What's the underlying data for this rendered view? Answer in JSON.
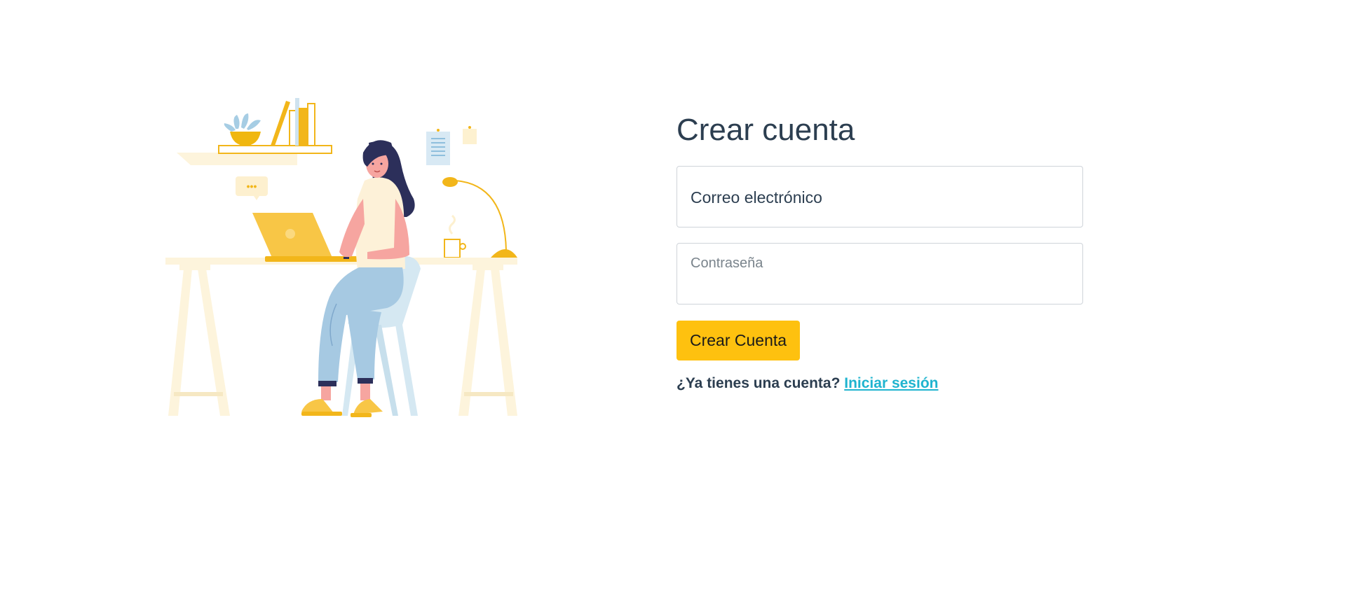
{
  "form": {
    "title": "Crear cuenta",
    "email_label": "Correo electrónico",
    "password_placeholder": "Contraseña",
    "submit_label": "Crear Cuenta",
    "login_prompt": "¿Ya tienes una cuenta?",
    "login_link": "Iniciar sesión"
  },
  "illustration": {
    "subject": "woman working on laptop at desk",
    "chat_bubble": "•••"
  },
  "colors": {
    "accent": "#fec10f",
    "link": "#1fb4cf",
    "text": "#2c3e50",
    "muted": "#7a848c",
    "border": "#cfd4d9"
  }
}
